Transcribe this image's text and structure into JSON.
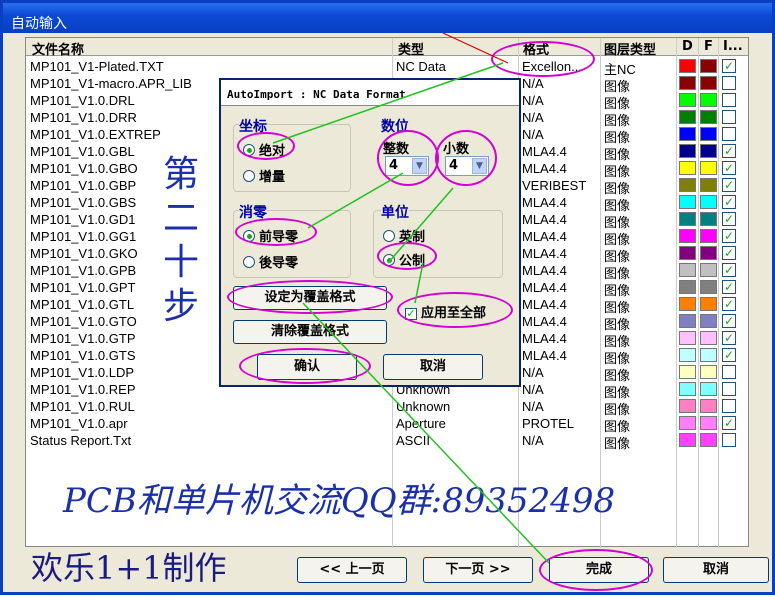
{
  "window": {
    "title": "自动输入"
  },
  "table": {
    "headers": {
      "name": "文件名称",
      "type": "类型",
      "format": "格式",
      "layer": "图层类型",
      "d": "D",
      "f": "F",
      "i": "I..."
    },
    "rows": [
      {
        "name": "MP101_V1-Plated.TXT",
        "type": "NC Data",
        "format": "Excellon...",
        "layer": "主NC",
        "color": "#ff0000",
        "color2": "#8b0000",
        "checked": true
      },
      {
        "name": "MP101_V1-macro.APR_LIB",
        "type": "",
        "format": "N/A",
        "layer": "图像",
        "color": "#8b0000",
        "color2": "#8b0000",
        "checked": false
      },
      {
        "name": "MP101_V1.0.DRL",
        "type": "",
        "format": "N/A",
        "layer": "图像",
        "color": "#00ff00",
        "color2": "#00ff00",
        "checked": false
      },
      {
        "name": "MP101_V1.0.DRR",
        "type": "",
        "format": "N/A",
        "layer": "图像",
        "color": "#008000",
        "color2": "#008000",
        "checked": false
      },
      {
        "name": "MP101_V1.0.EXTREP",
        "type": "",
        "format": "N/A",
        "layer": "图像",
        "color": "#0000ff",
        "color2": "#0000ff",
        "checked": false
      },
      {
        "name": "MP101_V1.0.GBL",
        "type": "",
        "format": "MLA4.4",
        "layer": "图像",
        "color": "#00008b",
        "color2": "#00008b",
        "checked": true
      },
      {
        "name": "MP101_V1.0.GBO",
        "type": "",
        "format": "MLA4.4",
        "layer": "图像",
        "color": "#ffff00",
        "color2": "#ffff00",
        "checked": true
      },
      {
        "name": "MP101_V1.0.GBP",
        "type": "",
        "format": "VERIBEST",
        "layer": "图像",
        "color": "#808000",
        "color2": "#808000",
        "checked": true
      },
      {
        "name": "MP101_V1.0.GBS",
        "type": "",
        "format": "MLA4.4",
        "layer": "图像",
        "color": "#00ffff",
        "color2": "#00ffff",
        "checked": true
      },
      {
        "name": "MP101_V1.0.GD1",
        "type": "",
        "format": "MLA4.4",
        "layer": "图像",
        "color": "#008080",
        "color2": "#008080",
        "checked": true
      },
      {
        "name": "MP101_V1.0.GG1",
        "type": "",
        "format": "MLA4.4",
        "layer": "图像",
        "color": "#ff00ff",
        "color2": "#ff00ff",
        "checked": true
      },
      {
        "name": "MP101_V1.0.GKO",
        "type": "",
        "format": "MLA4.4",
        "layer": "图像",
        "color": "#800080",
        "color2": "#800080",
        "checked": true
      },
      {
        "name": "MP101_V1.0.GPB",
        "type": "",
        "format": "MLA4.4",
        "layer": "图像",
        "color": "#c0c0c0",
        "color2": "#c0c0c0",
        "checked": true
      },
      {
        "name": "MP101_V1.0.GPT",
        "type": "",
        "format": "MLA4.4",
        "layer": "图像",
        "color": "#808080",
        "color2": "#808080",
        "checked": true
      },
      {
        "name": "MP101_V1.0.GTL",
        "type": "",
        "format": "MLA4.4",
        "layer": "图像",
        "color": "#ff8000",
        "color2": "#ff8000",
        "checked": true
      },
      {
        "name": "MP101_V1.0.GTO",
        "type": "",
        "format": "MLA4.4",
        "layer": "图像",
        "color": "#8080c0",
        "color2": "#8080c0",
        "checked": true
      },
      {
        "name": "MP101_V1.0.GTP",
        "type": "",
        "format": "MLA4.4",
        "layer": "图像",
        "color": "#ffc0ff",
        "color2": "#ffc0ff",
        "checked": true
      },
      {
        "name": "MP101_V1.0.GTS",
        "type": "",
        "format": "MLA4.4",
        "layer": "图像",
        "color": "#c0ffff",
        "color2": "#c0ffff",
        "checked": true
      },
      {
        "name": "MP101_V1.0.LDP",
        "type": "",
        "format": "N/A",
        "layer": "图像",
        "color": "#ffffc0",
        "color2": "#ffffc0",
        "checked": false
      },
      {
        "name": "MP101_V1.0.REP",
        "type": "Unknown",
        "format": "N/A",
        "layer": "图像",
        "color": "#80ffff",
        "color2": "#80ffff",
        "checked": false
      },
      {
        "name": "MP101_V1.0.RUL",
        "type": "Unknown",
        "format": "N/A",
        "layer": "图像",
        "color": "#ff80c0",
        "color2": "#ff80c0",
        "checked": false
      },
      {
        "name": "MP101_V1.0.apr",
        "type": "Aperture",
        "format": "PROTEL",
        "layer": "图像",
        "color": "#ff80ff",
        "color2": "#ff80ff",
        "checked": true
      },
      {
        "name": "Status Report.Txt",
        "type": "ASCII",
        "format": "N/A",
        "layer": "图像",
        "color": "#ff40ff",
        "color2": "#ff40ff",
        "checked": false
      }
    ]
  },
  "dialog": {
    "title": "AutoImport : NC Data Format",
    "coord_label": "坐标",
    "coord_abs": "绝对",
    "coord_inc": "增量",
    "digits_label": "数位",
    "int_label": "整数",
    "dec_label": "小数",
    "int_value": "4",
    "dec_value": "4",
    "zero_label": "消零",
    "zero_lead": "前导零",
    "zero_trail": "後导零",
    "unit_label": "单位",
    "unit_in": "英制",
    "unit_mm": "公制",
    "set_default": "设定为覆盖格式",
    "clear_default": "清除覆盖格式",
    "apply_all": "应用至全部",
    "ok": "确认",
    "cancel": "取消"
  },
  "footer": {
    "prev": "<< 上一页",
    "next": "下一页 >>",
    "finish": "完成",
    "cancel": "取消"
  },
  "overlay": {
    "step": "第二十步",
    "qq": "PCB和单片机交流QQ群:89352498",
    "made": "欢乐1+1制作"
  }
}
